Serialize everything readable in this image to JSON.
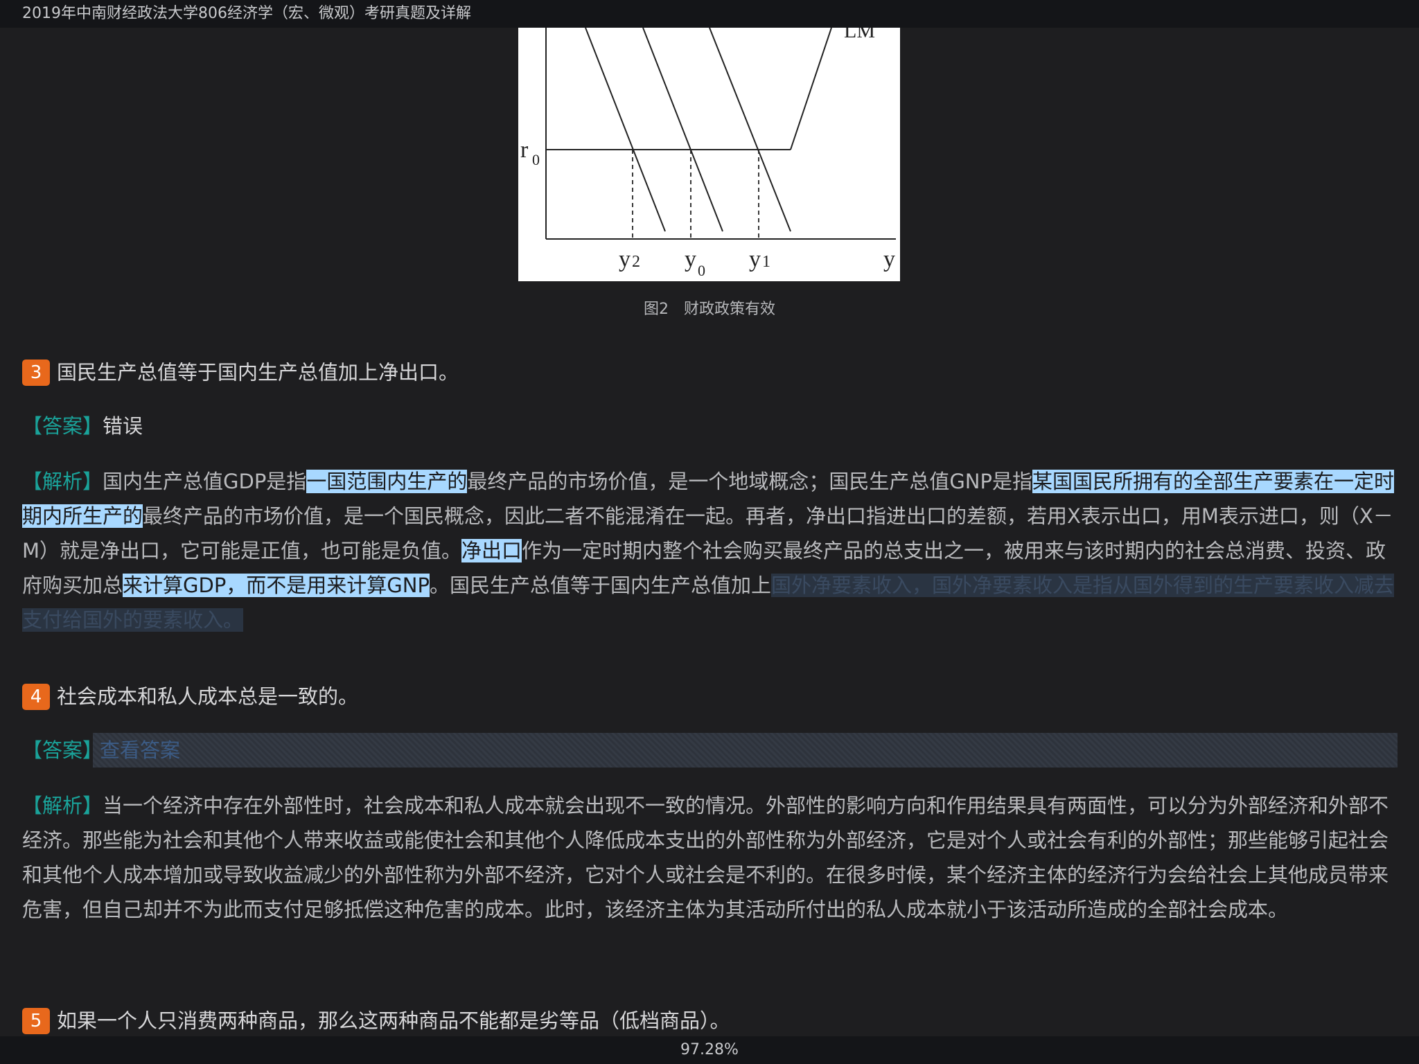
{
  "header": {
    "title": "2019年中南财经政法大学806经济学（宏、微观）考研真题及详解"
  },
  "figure": {
    "labels": {
      "lm": "LM",
      "r0": "r",
      "r0_sub": "0",
      "y2": "y",
      "y2_sub": "2",
      "y0": "y",
      "y0_sub": "0",
      "y1": "y",
      "y1_sub": "1",
      "y_axis": "y"
    },
    "caption": "图2　财政政策有效"
  },
  "q3": {
    "number": "3",
    "question": "国民生产总值等于国内生产总值加上净出口。",
    "answer_label": "【答案】",
    "answer": "错误",
    "analysis_label": "【解析】",
    "analysis": {
      "p1": "国内生产总值GDP是指",
      "h1": "一国范围内生产的",
      "p2": "最终产品的市场价值，是一个地域概念；国民生产总值GNP是指",
      "h2": "某国国民所拥有的全部生产要素在一定时期内所生产的",
      "p3": "最终产品的市场价值，是一个国民概念，因此二者不能混淆在一起。再者，净出口指进出口的差额，若用X表示出口，用M表示进口，则（X－M）就是净出口，它可能是正值，也可能是负值。",
      "h3": "净出口",
      "p4": "作为一定时期内整个社会购买最终产品的总支出之一，被用来与该时期内的社会总消费、投资、政府购买加总",
      "h4": "来计算GDP，而不是用来计算GNP",
      "p5": "。国民生产总值等于国内生产总值加上",
      "h5": "国外净要素收入，国外净要素收入是指从国外得到的生产要素收入减去支付给国外的要素收入。"
    }
  },
  "q4": {
    "number": "4",
    "question": "社会成本和私人成本总是一致的。",
    "answer_label": "【答案】",
    "reveal_button": "查看答案",
    "analysis_label": "【解析】",
    "analysis": "当一个经济中存在外部性时，社会成本和私人成本就会出现不一致的情况。外部性的影响方向和作用结果具有两面性，可以分为外部经济和外部不经济。那些能为社会和其他个人带来收益或能使社会和其他个人降低成本支出的外部性称为外部经济，它是对个人或社会有利的外部性；那些能够引起社会和其他个人成本增加或导致收益减少的外部性称为外部不经济，它对个人或社会是不利的。在很多时候，某个经济主体的经济行为会给社会上其他成员带来危害，但自己却并不为此而支付足够抵偿这种危害的成本。此时，该经济主体为其活动所付出的私人成本就小于该活动所造成的全部社会成本。"
  },
  "q5": {
    "number": "5",
    "question": "如果一个人只消费两种商品，那么这两种商品不能都是劣等品（低档商品）。"
  },
  "footer": {
    "progress": "97.28%"
  }
}
